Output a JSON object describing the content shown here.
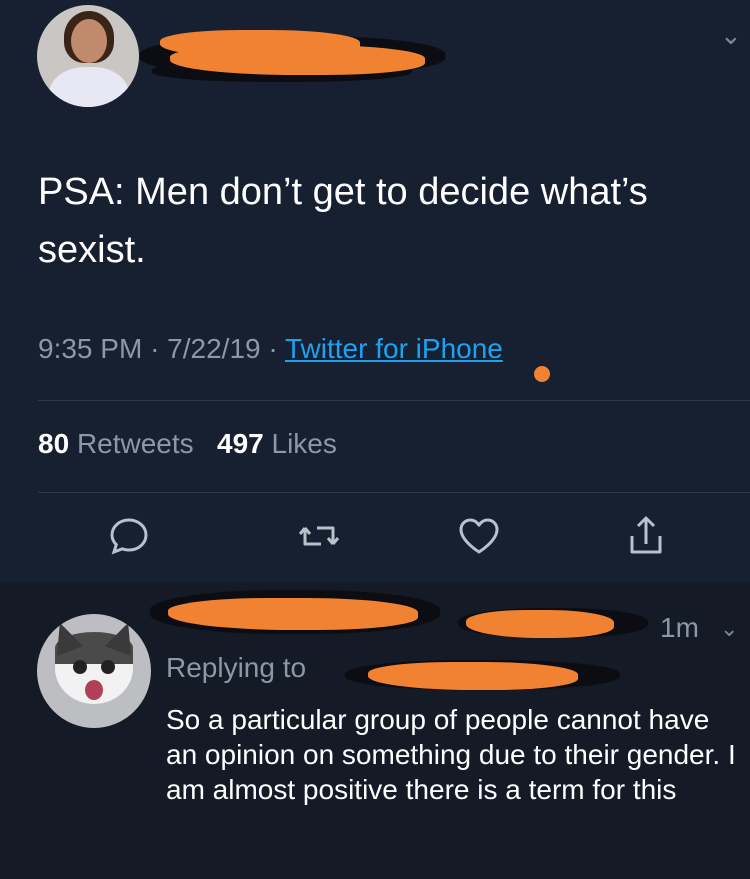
{
  "tweet": {
    "text": "PSA: Men don’t get to decide what’s sexist.",
    "time": "9:35 PM",
    "date": "7/22/19",
    "separator": "·",
    "source": "Twitter for iPhone",
    "retweets_count": "80",
    "retweets_label": "Retweets",
    "likes_count": "497",
    "likes_label": "Likes",
    "actions": [
      "reply-icon",
      "retweet-icon",
      "like-icon",
      "share-icon"
    ]
  },
  "reply": {
    "time": "1m",
    "replying_label": "Replying to",
    "text": "So a particular group of people cannot have an opinion on something due to their gender. I am almost positive there is a term for this"
  },
  "colors": {
    "background": "#162030",
    "link": "#1da1f2",
    "muted": "#8b98a5",
    "redaction": "#f08232"
  }
}
